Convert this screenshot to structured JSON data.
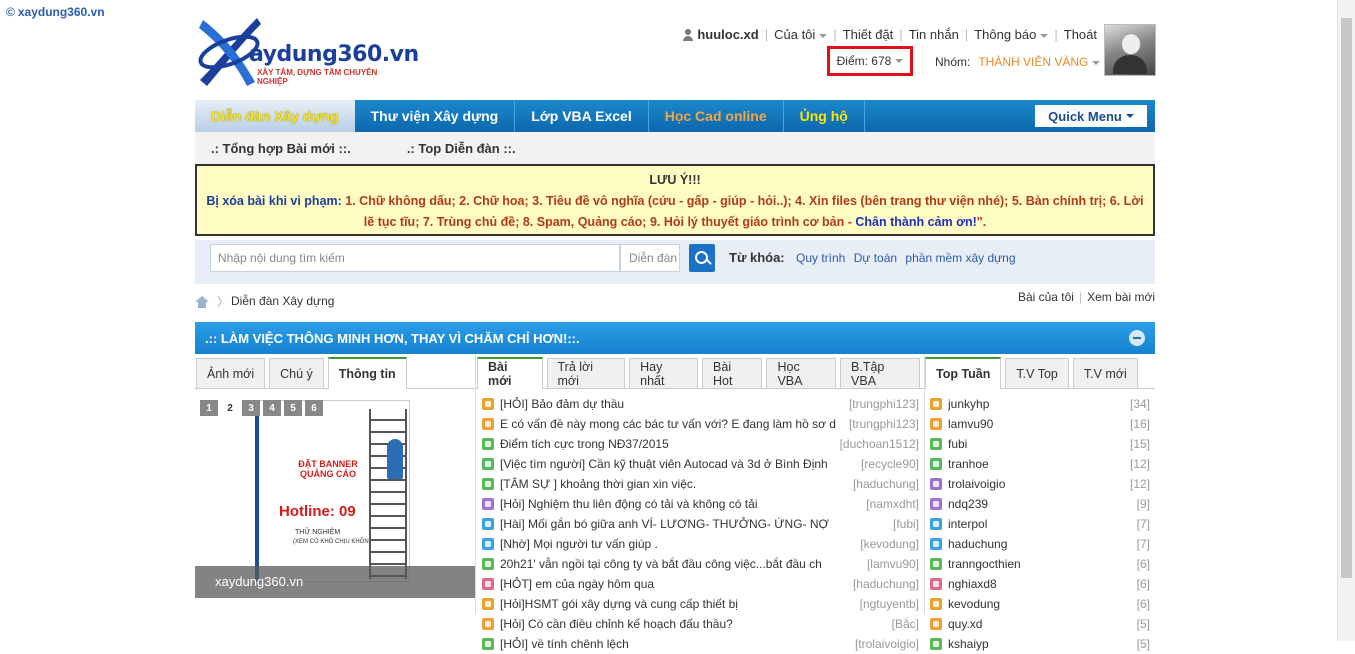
{
  "watermark": "xaydung360.vn",
  "logo": {
    "text": "aydung360.vn",
    "slogan": "XÂY TÂM, DỰNG TẦM CHUYÊN NGHIỆP"
  },
  "usernav": {
    "username": "huuloc.xd",
    "items": [
      "Của tôi",
      "Thiết đặt",
      "Tin nhắn",
      "Thông báo",
      "Thoát"
    ]
  },
  "points": {
    "label": "Điểm: 678"
  },
  "group": {
    "label": "Nhóm:",
    "value": "THÀNH VIÊN VÀNG"
  },
  "mainnav": {
    "items": [
      "Diễn đàn Xây dựng",
      "Thư viện Xây dựng",
      "Lớp VBA Excel",
      "Học Cad online",
      "Ủng hộ"
    ],
    "quick_menu": "Quick Menu"
  },
  "subnav": {
    "items": [
      ".: Tổng hợp Bài mới ::.",
      ".: Top Diễn đàn ::."
    ]
  },
  "notice": {
    "title": "LƯU Ý!!!",
    "label": "Bị xóa bài khi vi phạm:",
    "body": " 1. Chữ không dấu; 2. Chữ hoa; 3. Tiêu đề vô nghĩa (cứu - gấp - giúp - hỏi..); 4. Xin files (bên trang thư viện nhé); 5. Bàn chính trị; 6. Lời lẽ tục tĩu; 7. Trùng chủ đề; 8. Spam, Quảng cáo; 9. Hỏi lý thuyết giáo trình cơ bản - ",
    "thanks": "Chân thành cảm ơn!",
    "tail": "\"."
  },
  "search": {
    "placeholder": "Nhập nội dung tìm kiếm",
    "scope": "Diễn đàn",
    "keywords_label": "Từ khóa:",
    "keywords": [
      "Quy trình",
      "Dự toán",
      "phần mềm xây dựng"
    ]
  },
  "breadcrumb": {
    "current": "Diễn đàn Xây dựng",
    "right_links": [
      "Bài của tôi",
      "Xem bài mới"
    ]
  },
  "forum_header": {
    "title": ".:: LÀM VIỆC THÔNG MINH HƠN, THAY VÌ CHĂM CHỈ HƠN!::."
  },
  "left": {
    "tabs": [
      "Ảnh mới",
      "Chú ý",
      "Thông tin"
    ],
    "pages": [
      "1",
      "2",
      "3",
      "4",
      "5",
      "6"
    ],
    "banner": {
      "line1": "ĐẶT BANNER QUẢNG CÁO",
      "line2": "Hotline: 09",
      "line3": "THỬ NGHIỆM",
      "line4": "(XEM CÓ KHÓ CHỊU KHÔNG)"
    },
    "caption": "xaydung360.vn"
  },
  "middle": {
    "tabs": [
      "Bài mới",
      "Trả lời mới",
      "Hay nhất",
      "Bài Hot",
      "Học VBA",
      "B.Tập VBA"
    ],
    "posts": [
      {
        "title": "[HỎI] Bảo đảm dự thầu",
        "author": "[trungphi123]",
        "color": "#f0a030"
      },
      {
        "title": "E có vấn đề này mong các bác tư vấn với? E đang làm hồ sơ d",
        "author": "[trungphi123]",
        "color": "#f0a030"
      },
      {
        "title": "Điểm tích cực trong NĐ37/2015",
        "author": "[duchoan1512]",
        "color": "#5bb85b"
      },
      {
        "title": "[Việc tìm người] Cần kỹ thuật viên Autocad và 3d ở Bình Định",
        "author": "[recycle90]",
        "color": "#5bb85b"
      },
      {
        "title": "[TÂM SỰ ] khoảng thời gian xin việc.",
        "author": "[haduchung]",
        "color": "#5bb85b"
      },
      {
        "title": "[Hỏi] Nghiệm thu liên động có tải và không có tải",
        "author": "[namxdht]",
        "color": "#a070d0"
      },
      {
        "title": "[Hài] Mối gắn bó giữa anh VÍ- LƯƠNG- THƯỞNG- ỨNG- NỢ",
        "author": "[fubi]",
        "color": "#3aa0e0"
      },
      {
        "title": "[Nhờ] Mọi người tư vấn giúp .",
        "author": "[kevodung]",
        "color": "#3aa0e0"
      },
      {
        "title": "20h21' vẫn ngồi tại công ty và bắt đầu công việc...bắt đầu ch",
        "author": "[lamvu90]",
        "color": "#5bb85b"
      },
      {
        "title": "[HỎT] em của ngày hôm qua",
        "author": "[haduchung]",
        "color": "#e06a8a"
      },
      {
        "title": "[Hỏi]HSMT gói xây dựng và cung cấp thiết bị",
        "author": "[ngtuyentb]",
        "color": "#f0a030"
      },
      {
        "title": "[Hỏi] Có cần điều chỉnh kế hoạch đấu thầu?",
        "author": "[Bắc]",
        "color": "#f0a030"
      },
      {
        "title": "[HỎI] về tính chênh lệch",
        "author": "[trolaivoigio]",
        "color": "#5bb85b"
      }
    ]
  },
  "right": {
    "tabs": [
      "Top Tuần",
      "T.V Top",
      "T.V mới"
    ],
    "members": [
      {
        "name": "junkyhp",
        "count": "[34]",
        "color": "#f0a030"
      },
      {
        "name": "lamvu90",
        "count": "[16]",
        "color": "#f0a030"
      },
      {
        "name": "fubi",
        "count": "[15]",
        "color": "#5bb85b"
      },
      {
        "name": "tranhoe",
        "count": "[12]",
        "color": "#5bb85b"
      },
      {
        "name": "trolaivoigio",
        "count": "[12]",
        "color": "#a070d0"
      },
      {
        "name": "ndq239",
        "count": "[9]",
        "color": "#a070d0"
      },
      {
        "name": "interpol",
        "count": "[7]",
        "color": "#3aa0e0"
      },
      {
        "name": "haduchung",
        "count": "[7]",
        "color": "#3aa0e0"
      },
      {
        "name": "tranngocthien",
        "count": "[6]",
        "color": "#5bb85b"
      },
      {
        "name": "nghiaxd8",
        "count": "[6]",
        "color": "#e06a8a"
      },
      {
        "name": "kevodung",
        "count": "[6]",
        "color": "#f0a030"
      },
      {
        "name": "quy.xd",
        "count": "[5]",
        "color": "#f0a030"
      },
      {
        "name": "kshaiyp",
        "count": "[5]",
        "color": "#5bb85b"
      }
    ]
  }
}
